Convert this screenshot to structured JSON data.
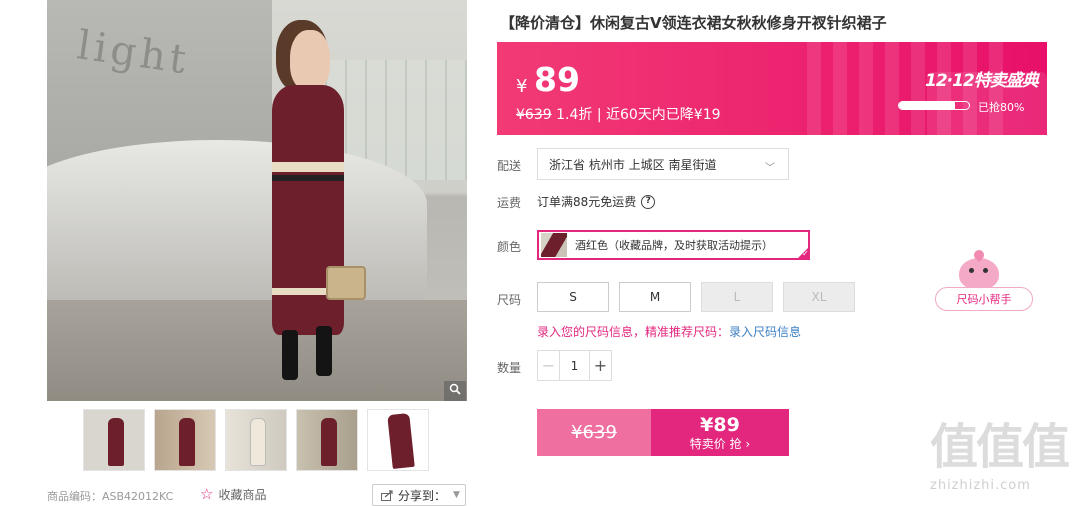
{
  "gallery": {
    "zoom_icon": "magnifier-icon",
    "main_photo_wall_text": "light",
    "thumbnails": [
      "thumbnail-1",
      "thumbnail-2",
      "thumbnail-3",
      "thumbnail-4",
      "thumbnail-5"
    ],
    "sku_text": "商品编码：ASB42012KC",
    "favorite_label": "收藏商品",
    "favorite_icon": "star-outline-icon",
    "share_label": "分享到：",
    "share_icon": "share-icon"
  },
  "product": {
    "title": "【降价清仓】休闲复古V领连衣裙女秋秋修身开衩针织裙子"
  },
  "price": {
    "currency": "¥",
    "current": "89",
    "original": "¥639",
    "discount": "1.4折",
    "note": "| 近60天内已降¥19",
    "brand_color": "#e8106a"
  },
  "promo": {
    "logo": "12·12特卖盛典",
    "progress": 0.8,
    "progress_text": "已抢80%"
  },
  "delivery": {
    "label": "配送",
    "address": "浙江省 杭州市 上城区 南星街道"
  },
  "shipping": {
    "label": "运费",
    "text": "订单满88元免运费"
  },
  "color": {
    "label": "颜色",
    "selected": "酒红色（收藏品牌，及时获取活动提示）"
  },
  "size": {
    "label": "尺码",
    "options": [
      {
        "label": "S",
        "available": true
      },
      {
        "label": "M",
        "available": true
      },
      {
        "label": "L",
        "available": false
      },
      {
        "label": "XL",
        "available": false
      }
    ],
    "tip": "录入您的尺码信息，精准推荐尺码：",
    "tip_link": "录入尺码信息",
    "helper_label": "尺码小帮手"
  },
  "quantity": {
    "label": "数量",
    "value": "1"
  },
  "buy": {
    "original": "¥639",
    "price": "¥89",
    "label": "特卖价 抢 ›"
  },
  "watermark": {
    "glyphs": "值值值",
    "url": "zhizhizhi.com"
  }
}
